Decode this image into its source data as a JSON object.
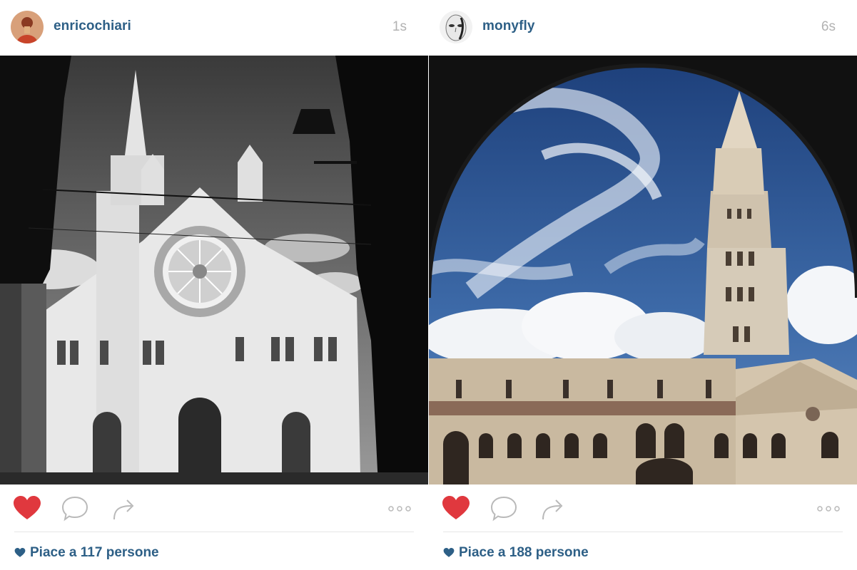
{
  "posts": [
    {
      "username": "enricochiari",
      "timestamp": "1s",
      "likes_text": "Piace a 117 persone",
      "liked": true,
      "avatar_icon": "profile-avatar",
      "actions": [
        "heart-icon",
        "comment-icon",
        "share-icon",
        "more-icon"
      ]
    },
    {
      "username": "monyfly",
      "timestamp": "6s",
      "likes_text": "Piace a 188 persone",
      "liked": true,
      "avatar_icon": "profile-avatar",
      "actions": [
        "heart-icon",
        "comment-icon",
        "share-icon",
        "more-icon"
      ]
    }
  ],
  "colors": {
    "username": "#2d5f86",
    "timestamp": "#b2b2b2",
    "like_red": "#e0383e",
    "icon_gray": "#b9b9b9",
    "separator": "#e6e6e6"
  }
}
